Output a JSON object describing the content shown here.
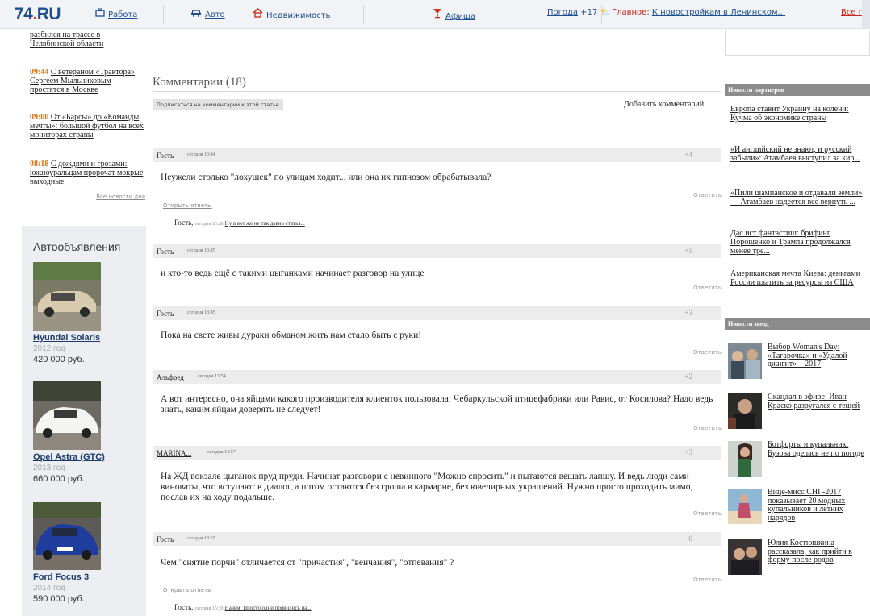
{
  "header": {
    "logo_main": "74",
    "logo_dot": ".",
    "logo_ru": "RU",
    "nav": [
      {
        "label": "Работа",
        "icon": "briefcase-icon"
      },
      {
        "label": "Авто",
        "icon": "car-icon"
      },
      {
        "label": "Недвижимость",
        "icon": "house-icon"
      },
      {
        "label": "Афиша",
        "icon": "cocktail-icon"
      }
    ],
    "weather_label": "Погода",
    "weather_value": "+17",
    "main_news_prefix": "Главное:",
    "main_news_link": "К новостройкам в Ленинском...",
    "all_news": "Все прое"
  },
  "left_news": [
    {
      "time": "",
      "title": "разбился на трассе в Челябинской области"
    },
    {
      "time": "09:44",
      "title": "С ветераном «Трактора» Сергеем Мыльниковым простятся в Москве"
    },
    {
      "time": "09:00",
      "title": "От «Барсы» до «Команды мечты»: большой футбол на всех мониторах страны"
    },
    {
      "time": "08:18",
      "title": "С дождями и грозами: южноуральцам пророчат мокрые выходные"
    }
  ],
  "all_day_news": "Все новости дня",
  "autos": {
    "title": "Автообъявления",
    "items": [
      {
        "name": "Hyundai Solaris",
        "year": "2012 год",
        "price": "420 000 руб."
      },
      {
        "name": "Opel Astra (GTC)",
        "year": "2013 год",
        "price": "660 000 руб."
      },
      {
        "name": "Ford Focus 3",
        "year": "2014 год",
        "price": "590 000 руб."
      }
    ]
  },
  "comments": {
    "title": "Комментарии (18)",
    "subscribe": "Подписаться на комментарии к этой статье",
    "add": "Добавить комментарий",
    "reply_label": "Ответить",
    "open_answers": "Открыть ответы",
    "items": [
      {
        "author": "Гость",
        "date": "сегодня 13:44",
        "score": "+4",
        "text": "Неужели столько \"лохушек\" по улицам ходит... или она их гипнозом обрабатывала?"
      },
      {
        "author": "Гость",
        "date": "сегодня 13:45",
        "score": "+5",
        "text": "и кто-то ведь ещё с такими цыганками начинает разговор на улице"
      },
      {
        "author": "Гость",
        "date": "сегодня 13:45",
        "score": "+3",
        "text": "Пока на свете живы дураки обманом жить нам стало быть с руки!"
      },
      {
        "author": "Альфред",
        "date": "сегодня 13:54",
        "score": "+2",
        "text": "А вот интересно, она яйцами какого производителя клиенток пользовала: Чебаркульской птицефабрики или Равис, от Косилова? Надо ведь знать, каким яйцам доверять не следует!"
      },
      {
        "author": "MARINA...",
        "date": "сегодня 13:57",
        "score": "+3",
        "text": "На ЖД вокзале цыганок пруд пруди. Начинат разговори с невинного \"Можно спросить\" и пытаются вешать лапшу. И ведь люди сами виноваты, что вступают в диалог, а потом остаются без гроша в кармарне, без ювелирных украшений. Нужно просто проходить мимо, послав их на ходу подальше."
      },
      {
        "author": "Гость",
        "date": "сегодня 13:57",
        "score": "0",
        "text": "Чем \"снятие порчи\" отличается от \"причастия\", \"венчания\", \"отпевания\" ?"
      }
    ],
    "answers": [
      {
        "author": "Гость",
        "date": "сегодня 15:28",
        "snippet": "Ну а вот же не так давно статья..."
      },
      {
        "author": "Гость",
        "date": "сегодня 15:30",
        "snippet": "Начем. Просто одни появились на..."
      }
    ]
  },
  "partners": {
    "title": "Новости партнеров",
    "items": [
      "Европа ставит Украину на колени: Кучма об экономике страны",
      "«И английский не знают, и русский забыли»: Атамбаев выступил за кир...",
      "«Пили шампанское и отдавали земли» — Атамбаев надеется все вернуть ...",
      "Дас ист фантастиш: брифинг Порошенко и Трампа продолжался менее тре...",
      "Американская мечта Киева: деньгами России платить за ресурсы из США"
    ]
  },
  "stars": {
    "title": "Новости звезд",
    "items": [
      "Выбор Woman's Day: «Тагарочка» и «Удалой джигит» – 2017",
      "Скандал в эфире: Иван Краско разругался с тещей",
      "Ботфорты и купальник: Бузова оделась не по погоде",
      "Вице-мисс СНГ-2017 показывает 20 модных купальников и летних нарядов",
      "Юлия Костюшкина рассказала, как прийти в форму после родов"
    ]
  }
}
